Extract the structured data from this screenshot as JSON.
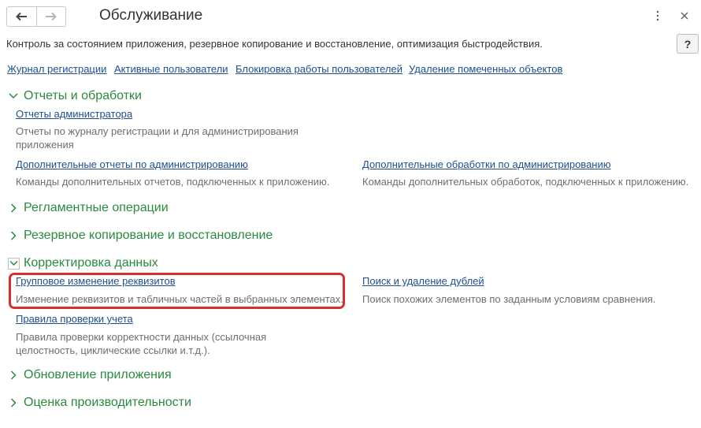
{
  "header": {
    "title": "Обслуживание",
    "description": "Контроль за состоянием приложения, резервное копирование и восстановление, оптимизация быстродействия.",
    "help_label": "?"
  },
  "top_links": [
    {
      "label": "Журнал регистрации"
    },
    {
      "label": "Активные пользователи"
    },
    {
      "label": "Блокировка работы пользователей"
    },
    {
      "label": "Удаление помеченных объектов"
    }
  ],
  "sections": {
    "reports": {
      "title": "Отчеты и обработки",
      "expanded": true,
      "items": [
        {
          "link": "Отчеты администратора",
          "note": "Отчеты по журналу регистрации и для администрирования приложения"
        },
        {
          "link": "Дополнительные отчеты по администрированию",
          "note": "Команды дополнительных отчетов, подключенных к приложению."
        },
        {
          "link": "Дополнительные обработки по администрированию",
          "note": "Команды дополнительных обработок, подключенных к приложению."
        }
      ]
    },
    "routine": {
      "title": "Регламентные операции",
      "expanded": false
    },
    "backup": {
      "title": "Резервное копирование и восстановление",
      "expanded": false
    },
    "correction": {
      "title": "Корректировка данных",
      "expanded": true,
      "items": [
        {
          "link": "Групповое изменение реквизитов",
          "note": "Изменение реквизитов и табличных частей в выбранных элементах.",
          "highlighted": true
        },
        {
          "link": "Поиск и удаление дублей",
          "note": "Поиск похожих элементов по заданным условиям сравнения."
        },
        {
          "link": "Правила проверки учета",
          "note": "Правила проверки корректности данных (ссылочная целостность, циклические ссылки и.т.д.)."
        }
      ]
    },
    "update": {
      "title": "Обновление приложения",
      "expanded": false
    },
    "performance": {
      "title": "Оценка производительности",
      "expanded": false
    }
  },
  "icons": {
    "back": "arrow-left-icon",
    "forward": "arrow-right-icon",
    "more": "more-vertical-icon",
    "close": "close-icon",
    "collapsed": "chevron-right-icon",
    "expanded": "chevron-down-icon"
  },
  "colors": {
    "section_title": "#2a8a3e",
    "link": "#1d4f91",
    "note": "#6e6e6e",
    "highlight_border": "#d9302c"
  }
}
